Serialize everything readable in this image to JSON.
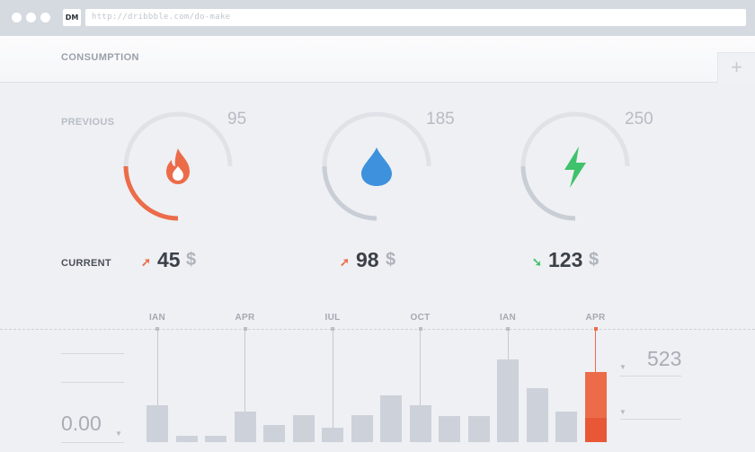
{
  "browser": {
    "favicon_text": "DM",
    "url": "http://dribbble.com/do-make"
  },
  "header": {
    "title": "CONSUMPTION",
    "add_label": "+"
  },
  "labels": {
    "previous": "PREVIOUS",
    "current": "CURRENT"
  },
  "meters": [
    {
      "icon": "flame-icon",
      "previous": "95",
      "current": "45",
      "unit": "$",
      "trend": "up",
      "trend_glyph": "➚",
      "accent": "#ec6c4a",
      "fill": 0.25,
      "fill_color": "#ec6c4a"
    },
    {
      "icon": "water-drop-icon",
      "previous": "185",
      "current": "98",
      "unit": "$",
      "trend": "up",
      "trend_glyph": "➚",
      "accent": "#3e91dc",
      "fill": 0.25,
      "fill_color": "#c9ced6"
    },
    {
      "icon": "lightning-icon",
      "previous": "250",
      "current": "123",
      "unit": "$",
      "trend": "down",
      "trend_glyph": "➘",
      "accent": "#3fc26b",
      "fill": 0.25,
      "fill_color": "#c9ced6"
    }
  ],
  "colors": {
    "bar_default": "#cdd1d9",
    "bar_highlight": "#ec6c4a",
    "bar_highlight_dark": "#e85836",
    "trend_up": "#ec6c4a",
    "trend_down": "#3fc26b"
  },
  "chart_data": {
    "type": "bar",
    "month_labels": [
      "IAN",
      "APR",
      "IUL",
      "OCT",
      "IAN",
      "APR"
    ],
    "values": [
      45,
      8,
      8,
      37,
      21,
      33,
      17,
      33,
      57,
      45,
      32,
      32,
      100,
      65,
      37,
      85
    ],
    "highlight_index": 15,
    "highlight_split": 0.34,
    "left_value": "0.00",
    "right_value": "523"
  }
}
